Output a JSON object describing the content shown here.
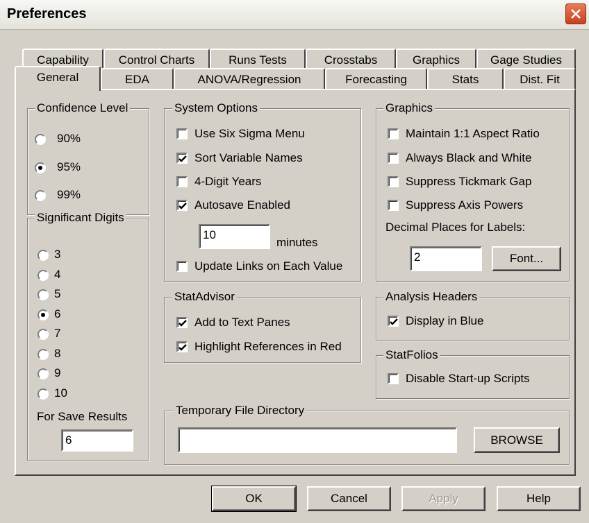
{
  "window": {
    "title": "Preferences"
  },
  "tabs": {
    "row1": [
      "Capability",
      "Control Charts",
      "Runs Tests",
      "Crosstabs",
      "Graphics",
      "Gage Studies"
    ],
    "row2": [
      "General",
      "EDA",
      "ANOVA/Regression",
      "Forecasting",
      "Stats",
      "Dist. Fit"
    ],
    "active": "General"
  },
  "confidence": {
    "title": "Confidence Level",
    "options": [
      "90%",
      "95%",
      "99%"
    ],
    "selected": "95%"
  },
  "digits": {
    "title": "Significant Digits",
    "options": [
      "3",
      "4",
      "5",
      "6",
      "7",
      "8",
      "9",
      "10"
    ],
    "selected": "6",
    "save_label": "For Save Results",
    "save_value": "6"
  },
  "system": {
    "title": "System Options",
    "six_sigma": {
      "label": "Use Six Sigma Menu",
      "checked": false
    },
    "sort_vars": {
      "label": "Sort Variable Names",
      "checked": true
    },
    "four_digit": {
      "label": "4-Digit Years",
      "checked": false
    },
    "autosave": {
      "label": "Autosave Enabled",
      "checked": true
    },
    "autosave_minutes": "10",
    "minutes_label": "minutes",
    "update_links": {
      "label": "Update Links on Each Value",
      "checked": false
    }
  },
  "statadvisor": {
    "title": "StatAdvisor",
    "add_text": {
      "label": "Add to Text Panes",
      "checked": true
    },
    "highlight": {
      "label": "Highlight References in Red",
      "checked": true
    }
  },
  "graphics": {
    "title": "Graphics",
    "aspect": {
      "label": "Maintain 1:1 Aspect Ratio",
      "checked": false
    },
    "bw": {
      "label": "Always Black and White",
      "checked": false
    },
    "tick_gap": {
      "label": "Suppress Tickmark Gap",
      "checked": false
    },
    "axis_powers": {
      "label": "Suppress Axis Powers",
      "checked": false
    },
    "decimal_label": "Decimal Places for Labels:",
    "decimal_value": "2",
    "font_button": "Font..."
  },
  "headers": {
    "title": "Analysis Headers",
    "blue": {
      "label": "Display in Blue",
      "checked": true
    }
  },
  "statfolios": {
    "title": "StatFolios",
    "disable": {
      "label": "Disable Start-up Scripts",
      "checked": false
    }
  },
  "temp": {
    "title": "Temporary File Directory",
    "value": "",
    "browse": "BROWSE"
  },
  "footer": {
    "ok": "OK",
    "cancel": "Cancel",
    "apply": "Apply",
    "help": "Help"
  },
  "colors": {
    "face": "#d4d0c8",
    "close": "#c6421e"
  }
}
